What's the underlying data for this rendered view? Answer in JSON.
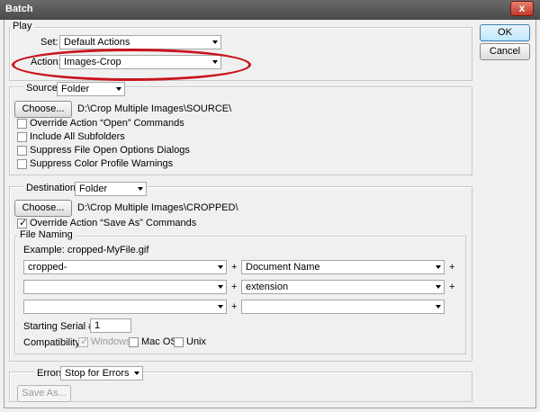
{
  "window": {
    "title": "Batch",
    "close_glyph": "x"
  },
  "buttons": {
    "ok": "OK",
    "cancel": "Cancel"
  },
  "play": {
    "legend": "Play",
    "set_label": "Set:",
    "set_value": "Default Actions",
    "action_label": "Action:",
    "action_value": "Images-Crop"
  },
  "source": {
    "label": "Source:",
    "value": "Folder",
    "choose_label": "Choose...",
    "path": "D:\\Crop Multiple Images\\SOURCE\\",
    "options": [
      {
        "label": "Override Action “Open” Commands",
        "checked": false
      },
      {
        "label": "Include All Subfolders",
        "checked": false
      },
      {
        "label": "Suppress File Open Options Dialogs",
        "checked": false
      },
      {
        "label": "Suppress Color Profile Warnings",
        "checked": false
      }
    ]
  },
  "destination": {
    "label": "Destination:",
    "value": "Folder",
    "choose_label": "Choose...",
    "path": "D:\\Crop Multiple Images\\CROPPED\\",
    "override_label": "Override Action “Save As” Commands",
    "override_checked": true
  },
  "file_naming": {
    "legend": "File Naming",
    "example": "Example: cropped-MyFile.gif",
    "fields": [
      "cropped-",
      "Document Name",
      "",
      "extension",
      "",
      ""
    ],
    "plus": "+",
    "serial_label": "Starting Serial #:",
    "serial_value": "1",
    "compat_label": "Compatibility:",
    "compat": [
      {
        "label": "Windows",
        "checked": true,
        "disabled": true
      },
      {
        "label": "Mac OS",
        "checked": false,
        "disabled": false
      },
      {
        "label": "Unix",
        "checked": false,
        "disabled": false
      }
    ]
  },
  "errors": {
    "label": "Errors:",
    "value": "Stop for Errors",
    "save_as_label": "Save As..."
  },
  "annotation": {
    "color": "#c8141e"
  },
  "check_glyph": "✓"
}
